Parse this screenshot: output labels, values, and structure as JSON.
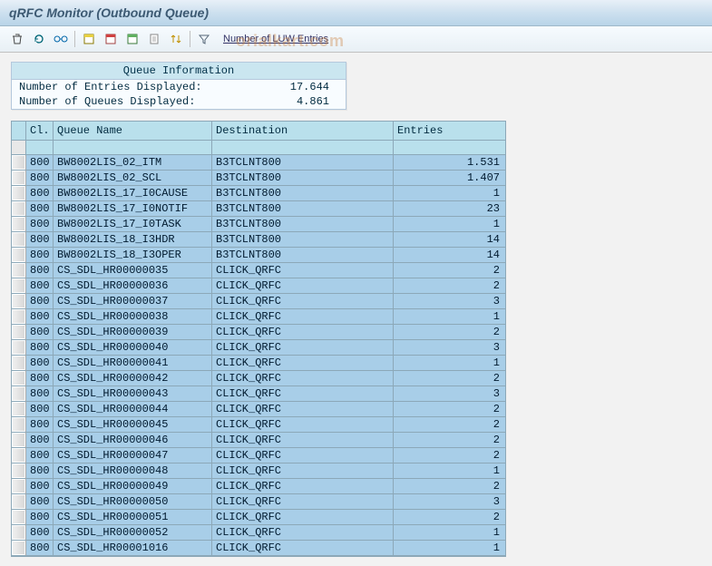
{
  "title": "qRFC Monitor (Outbound Queue)",
  "toolbar": {
    "luw_label": "Number of LUW Entries"
  },
  "info": {
    "header": "Queue Information",
    "row1_label": "Number of Entries Displayed:",
    "row1_value": "17.644",
    "row2_label": "Number of Queues Displayed:",
    "row2_value": "4.861"
  },
  "columns": {
    "cl": "Cl.",
    "qn": "Queue Name",
    "dest": "Destination",
    "entries": "Entries"
  },
  "rows": [
    {
      "cl": "800",
      "qn": "BW8002LIS_02_ITM",
      "dest": "B3TCLNT800",
      "entries": "1.531"
    },
    {
      "cl": "800",
      "qn": "BW8002LIS_02_SCL",
      "dest": "B3TCLNT800",
      "entries": "1.407"
    },
    {
      "cl": "800",
      "qn": "BW8002LIS_17_I0CAUSE",
      "dest": "B3TCLNT800",
      "entries": "1"
    },
    {
      "cl": "800",
      "qn": "BW8002LIS_17_I0NOTIF",
      "dest": "B3TCLNT800",
      "entries": "23"
    },
    {
      "cl": "800",
      "qn": "BW8002LIS_17_I0TASK",
      "dest": "B3TCLNT800",
      "entries": "1"
    },
    {
      "cl": "800",
      "qn": "BW8002LIS_18_I3HDR",
      "dest": "B3TCLNT800",
      "entries": "14"
    },
    {
      "cl": "800",
      "qn": "BW8002LIS_18_I3OPER",
      "dest": "B3TCLNT800",
      "entries": "14"
    },
    {
      "cl": "800",
      "qn": "CS_SDL_HR00000035",
      "dest": "CLICK_QRFC",
      "entries": "2"
    },
    {
      "cl": "800",
      "qn": "CS_SDL_HR00000036",
      "dest": "CLICK_QRFC",
      "entries": "2"
    },
    {
      "cl": "800",
      "qn": "CS_SDL_HR00000037",
      "dest": "CLICK_QRFC",
      "entries": "3"
    },
    {
      "cl": "800",
      "qn": "CS_SDL_HR00000038",
      "dest": "CLICK_QRFC",
      "entries": "1"
    },
    {
      "cl": "800",
      "qn": "CS_SDL_HR00000039",
      "dest": "CLICK_QRFC",
      "entries": "2"
    },
    {
      "cl": "800",
      "qn": "CS_SDL_HR00000040",
      "dest": "CLICK_QRFC",
      "entries": "3"
    },
    {
      "cl": "800",
      "qn": "CS_SDL_HR00000041",
      "dest": "CLICK_QRFC",
      "entries": "1"
    },
    {
      "cl": "800",
      "qn": "CS_SDL_HR00000042",
      "dest": "CLICK_QRFC",
      "entries": "2"
    },
    {
      "cl": "800",
      "qn": "CS_SDL_HR00000043",
      "dest": "CLICK_QRFC",
      "entries": "3"
    },
    {
      "cl": "800",
      "qn": "CS_SDL_HR00000044",
      "dest": "CLICK_QRFC",
      "entries": "2"
    },
    {
      "cl": "800",
      "qn": "CS_SDL_HR00000045",
      "dest": "CLICK_QRFC",
      "entries": "2"
    },
    {
      "cl": "800",
      "qn": "CS_SDL_HR00000046",
      "dest": "CLICK_QRFC",
      "entries": "2"
    },
    {
      "cl": "800",
      "qn": "CS_SDL_HR00000047",
      "dest": "CLICK_QRFC",
      "entries": "2"
    },
    {
      "cl": "800",
      "qn": "CS_SDL_HR00000048",
      "dest": "CLICK_QRFC",
      "entries": "1"
    },
    {
      "cl": "800",
      "qn": "CS_SDL_HR00000049",
      "dest": "CLICK_QRFC",
      "entries": "2"
    },
    {
      "cl": "800",
      "qn": "CS_SDL_HR00000050",
      "dest": "CLICK_QRFC",
      "entries": "3"
    },
    {
      "cl": "800",
      "qn": "CS_SDL_HR00000051",
      "dest": "CLICK_QRFC",
      "entries": "2"
    },
    {
      "cl": "800",
      "qn": "CS_SDL_HR00000052",
      "dest": "CLICK_QRFC",
      "entries": "1"
    },
    {
      "cl": "800",
      "qn": "CS_SDL_HR00001016",
      "dest": "CLICK_QRFC",
      "entries": "1"
    }
  ],
  "watermark": "orialkart.com"
}
